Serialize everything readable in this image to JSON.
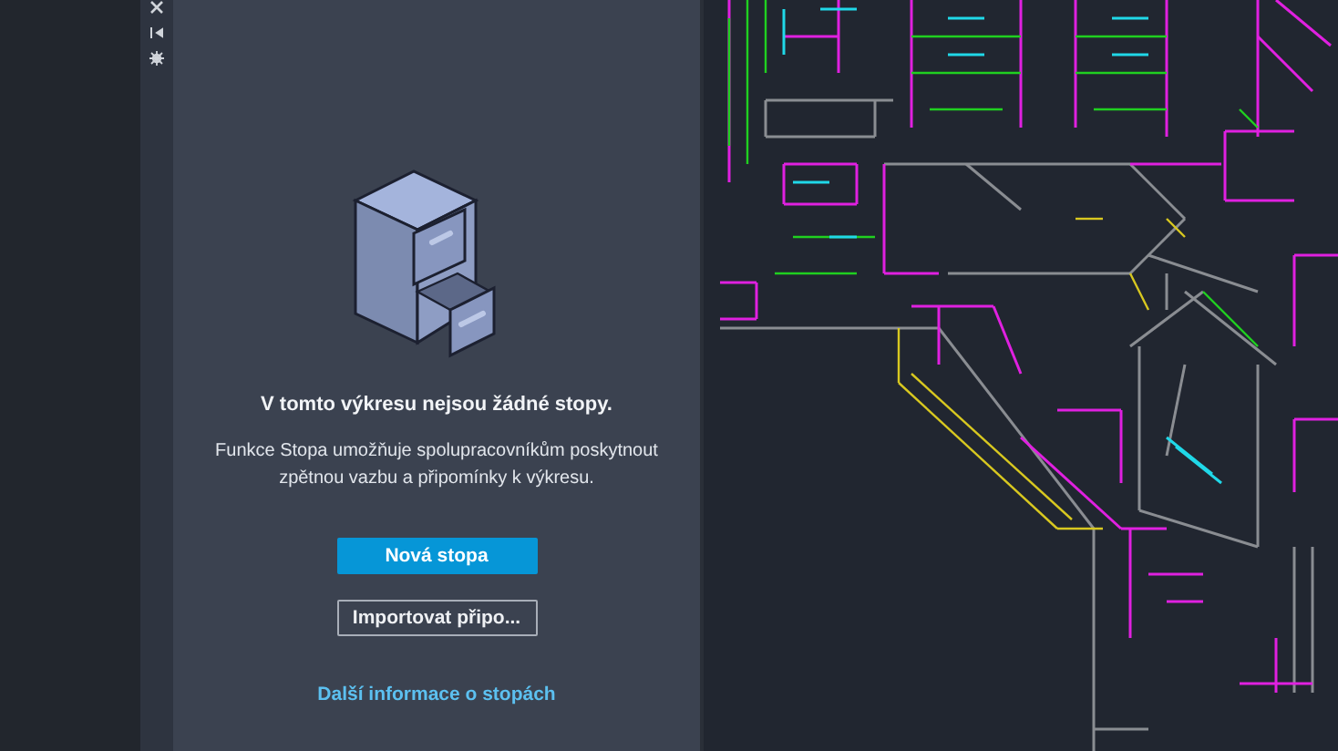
{
  "panel": {
    "heading": "V tomto výkresu nejsou žádné stopy.",
    "description": "Funkce Stopa umožňuje spolupracovníkům poskytnout zpětnou vazbu a připomínky k výkresu.",
    "buttons": [
      {
        "label": "Nová stopa",
        "kind": "primary"
      },
      {
        "label": "Importovat připo...",
        "kind": "secondary"
      }
    ],
    "link": "Další informace o stopách"
  }
}
